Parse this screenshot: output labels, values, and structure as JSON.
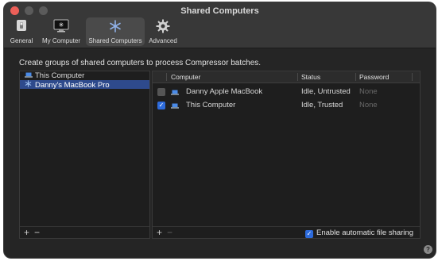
{
  "window": {
    "title": "Shared Computers"
  },
  "toolbar": {
    "items": [
      {
        "label": "General",
        "icon": "general-switch-icon"
      },
      {
        "label": "My Computer",
        "icon": "monitor-icon"
      },
      {
        "label": "Shared Computers",
        "icon": "cluster-asterisk-icon",
        "selected": true
      },
      {
        "label": "Advanced",
        "icon": "gear-icon"
      }
    ]
  },
  "main": {
    "instruction": "Create groups of shared computers to process Compressor batches.",
    "groups": [
      {
        "label": "This Computer",
        "icon": "laptop-icon"
      },
      {
        "label": "Danny's MacBook Pro",
        "icon": "asterisk-icon",
        "selected": true
      }
    ],
    "table": {
      "headers": {
        "computer": "Computer",
        "status": "Status",
        "password": "Password"
      },
      "rows": [
        {
          "checked": false,
          "computer": "Danny Apple MacBook",
          "status": "Idle, Untrusted",
          "password": "None"
        },
        {
          "checked": true,
          "computer": "This Computer",
          "status": "Idle, Trusted",
          "password": "None"
        }
      ]
    },
    "add_symbol": "+",
    "remove_symbol": "−",
    "file_sharing": {
      "label": "Enable automatic file sharing",
      "checked": true
    },
    "help_symbol": "?"
  },
  "colors": {
    "accent": "#2d6bdc",
    "selection": "#2e4a8c",
    "close": "#ec5f58"
  }
}
